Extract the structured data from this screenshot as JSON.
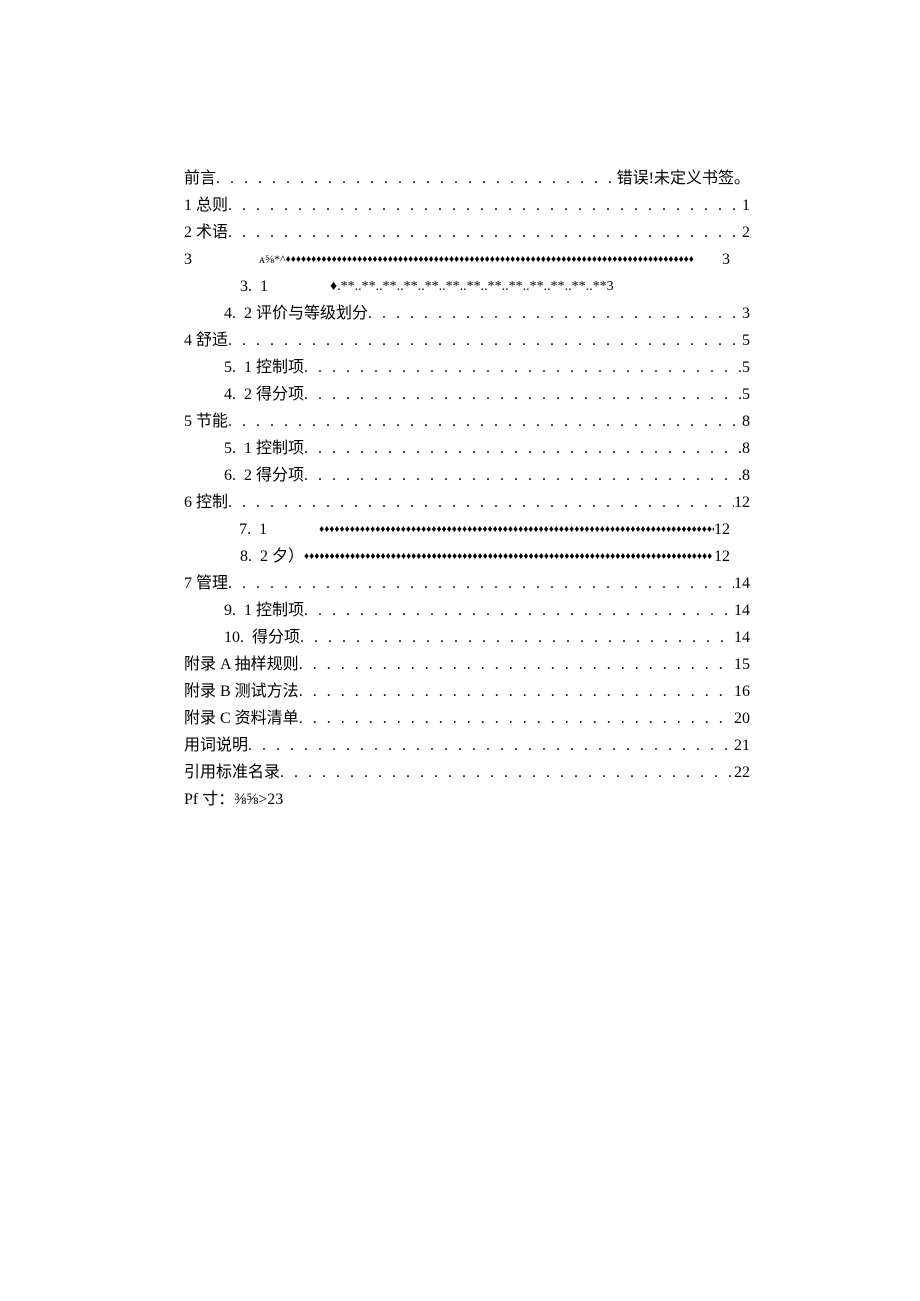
{
  "toc": {
    "preface": {
      "label": "前言",
      "page": "错误!未定义书签。"
    },
    "s1": {
      "label": "1 总则",
      "page": "1"
    },
    "s2": {
      "label": "2 术语",
      "page": "2"
    },
    "s3": {
      "label": "3",
      "leader_sym": "♦",
      "prefix": "ᴀ⅝*^",
      "page": "3"
    },
    "s3_1": {
      "num": "3.",
      "sub": "1",
      "leader_text": "♦.**..**..**..**..**..**..**..**..**..**..**..**..**3"
    },
    "s3_2": {
      "num": "4.",
      "sub": "2 评价与等级划分",
      "page": "3"
    },
    "s4": {
      "label": "4 舒适",
      "page": "5"
    },
    "s4_1": {
      "num": "5.",
      "sub": "1 控制项",
      "page": "5"
    },
    "s4_2": {
      "num": "4.",
      "sub": "2 得分项",
      "page": "5"
    },
    "s5": {
      "label": "5 节能",
      "page": "8"
    },
    "s5_1": {
      "num": "5.",
      "sub": "1 控制项",
      "page": "8"
    },
    "s5_2": {
      "num": "6.",
      "sub": "2 得分项",
      "page": "8"
    },
    "s6": {
      "label": "6 控制",
      "page": "12"
    },
    "s6_1": {
      "num": "7.",
      "sub": "1",
      "leader_sym": "♦",
      "page": "12"
    },
    "s6_2": {
      "num": "8.",
      "sub": "2 夕）",
      "leader_sym": "♦",
      "page": "12"
    },
    "s7": {
      "label": "7 管理",
      "page": "14"
    },
    "s7_1": {
      "num": "9.",
      "sub": "1 控制项",
      "page": "14"
    },
    "s7_2": {
      "num": "10.",
      "sub": "得分项",
      "page": "14"
    },
    "appA": {
      "label": "附录 A 抽样规则",
      "page": "15"
    },
    "appB": {
      "label": "附录 B 测试方法",
      "page": "16"
    },
    "appC": {
      "label": "附录 C 资料清单",
      "page": "20"
    },
    "terms": {
      "label": "用词说明",
      "page": "21"
    },
    "refs": {
      "label": "引用标准名录",
      "page": "22"
    },
    "pf": {
      "label": "Pf 寸：⅜⅝>23"
    }
  },
  "leaders": {
    "dots": ". . . . . . . . . . . . . . . . . . . . . . . . . . . . . . . . . . . . . . . . . . . . . . . . . . . . . . . . . . . . . . . . . . . . . . . . . . . . . . . . . . . . . . . . . . . . . . . . . . . . . . . . . . . . . . . . . . . . . . . . . . . . . . . . . . ",
    "diamonds": "♦♦♦♦♦♦♦♦♦♦♦♦♦♦♦♦♦♦♦♦♦♦♦♦♦♦♦♦♦♦♦♦♦♦♦♦♦♦♦♦♦♦♦♦♦♦♦♦♦♦♦♦♦♦♦♦♦♦♦♦♦♦♦♦♦♦♦♦♦♦♦♦♦♦♦♦♦♦♦♦"
  }
}
